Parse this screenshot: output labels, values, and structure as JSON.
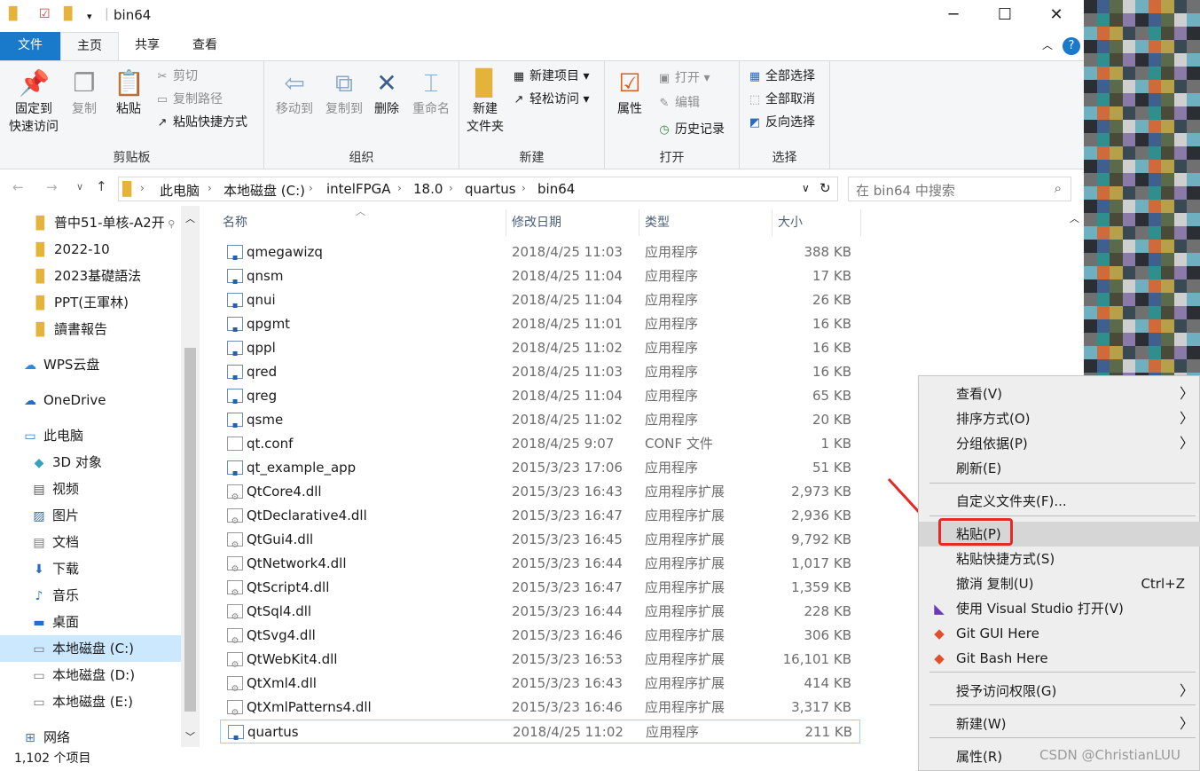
{
  "window": {
    "title": "bin64"
  },
  "tabs": [
    "文件",
    "主页",
    "共享",
    "查看"
  ],
  "ribbon": {
    "clipboard": {
      "label": "剪贴板",
      "pin": "固定到\n快速访问",
      "pin1": "固定到",
      "pin2": "快速访问",
      "copy": "复制",
      "paste": "粘贴",
      "cut": "剪切",
      "copy_path": "复制路径",
      "paste_shortcut": "粘贴快捷方式"
    },
    "organize": {
      "label": "组织",
      "move_to": "移动到",
      "copy_to": "复制到",
      "delete": "删除",
      "rename": "重命名"
    },
    "new": {
      "label": "新建",
      "new_folder1": "新建",
      "new_folder2": "文件夹",
      "new_item": "新建项目",
      "easy_access": "轻松访问"
    },
    "open": {
      "label": "打开",
      "properties": "属性",
      "open": "打开",
      "edit": "编辑",
      "history": "历史记录"
    },
    "select": {
      "label": "选择",
      "select_all": "全部选择",
      "select_none": "全部取消",
      "invert": "反向选择"
    }
  },
  "address": {
    "crumbs": [
      "此电脑",
      "本地磁盘 (C:)",
      "intelFPGA",
      "18.0",
      "quartus",
      "bin64"
    ],
    "search_placeholder": "在 bin64 中搜索"
  },
  "nav": {
    "items": [
      {
        "label": "普中51-单核-A2开",
        "icon": "folder-icon"
      },
      {
        "label": "2022-10",
        "icon": "folder-icon"
      },
      {
        "label": "2023基礎語法",
        "icon": "folder-icon"
      },
      {
        "label": "PPT(王軍林)",
        "icon": "folder-icon"
      },
      {
        "label": "讀書報告",
        "icon": "folder-icon"
      },
      {
        "label": "WPS云盘",
        "icon": "cloud-icon"
      },
      {
        "label": "OneDrive",
        "icon": "onedrive-icon"
      },
      {
        "label": "此电脑",
        "icon": "computer-icon"
      },
      {
        "label": "3D 对象",
        "icon": "cube-icon"
      },
      {
        "label": "视频",
        "icon": "video-icon"
      },
      {
        "label": "图片",
        "icon": "picture-icon"
      },
      {
        "label": "文档",
        "icon": "document-icon"
      },
      {
        "label": "下载",
        "icon": "download-icon"
      },
      {
        "label": "音乐",
        "icon": "music-icon"
      },
      {
        "label": "桌面",
        "icon": "desktop-icon"
      },
      {
        "label": "本地磁盘 (C:)",
        "icon": "drive-icon"
      },
      {
        "label": "本地磁盘 (D:)",
        "icon": "drive-icon"
      },
      {
        "label": "本地磁盘 (E:)",
        "icon": "drive-icon"
      },
      {
        "label": "网络",
        "icon": "network-icon"
      }
    ]
  },
  "columns": {
    "name": "名称",
    "date": "修改日期",
    "type": "类型",
    "size": "大小"
  },
  "files": [
    {
      "name": "qmegawizq",
      "date": "2018/4/25 11:03",
      "type": "应用程序",
      "size": "388 KB"
    },
    {
      "name": "qnsm",
      "date": "2018/4/25 11:04",
      "type": "应用程序",
      "size": "17 KB"
    },
    {
      "name": "qnui",
      "date": "2018/4/25 11:04",
      "type": "应用程序",
      "size": "26 KB"
    },
    {
      "name": "qpgmt",
      "date": "2018/4/25 11:01",
      "type": "应用程序",
      "size": "16 KB"
    },
    {
      "name": "qppl",
      "date": "2018/4/25 11:02",
      "type": "应用程序",
      "size": "16 KB"
    },
    {
      "name": "qred",
      "date": "2018/4/25 11:03",
      "type": "应用程序",
      "size": "16 KB"
    },
    {
      "name": "qreg",
      "date": "2018/4/25 11:04",
      "type": "应用程序",
      "size": "65 KB"
    },
    {
      "name": "qsme",
      "date": "2018/4/25 11:02",
      "type": "应用程序",
      "size": "20 KB"
    },
    {
      "name": "qt.conf",
      "date": "2018/4/25 9:07",
      "type": "CONF 文件",
      "size": "1 KB"
    },
    {
      "name": "qt_example_app",
      "date": "2015/3/23 17:06",
      "type": "应用程序",
      "size": "51 KB"
    },
    {
      "name": "QtCore4.dll",
      "date": "2015/3/23 16:43",
      "type": "应用程序扩展",
      "size": "2,973 KB"
    },
    {
      "name": "QtDeclarative4.dll",
      "date": "2015/3/23 16:47",
      "type": "应用程序扩展",
      "size": "2,936 KB"
    },
    {
      "name": "QtGui4.dll",
      "date": "2015/3/23 16:45",
      "type": "应用程序扩展",
      "size": "9,792 KB"
    },
    {
      "name": "QtNetwork4.dll",
      "date": "2015/3/23 16:44",
      "type": "应用程序扩展",
      "size": "1,017 KB"
    },
    {
      "name": "QtScript4.dll",
      "date": "2015/3/23 16:47",
      "type": "应用程序扩展",
      "size": "1,359 KB"
    },
    {
      "name": "QtSql4.dll",
      "date": "2015/3/23 16:44",
      "type": "应用程序扩展",
      "size": "228 KB"
    },
    {
      "name": "QtSvg4.dll",
      "date": "2015/3/23 16:46",
      "type": "应用程序扩展",
      "size": "306 KB"
    },
    {
      "name": "QtWebKit4.dll",
      "date": "2015/3/23 16:53",
      "type": "应用程序扩展",
      "size": "16,101 KB"
    },
    {
      "name": "QtXml4.dll",
      "date": "2015/3/23 16:43",
      "type": "应用程序扩展",
      "size": "414 KB"
    },
    {
      "name": "QtXmlPatterns4.dll",
      "date": "2015/3/23 16:46",
      "type": "应用程序扩展",
      "size": "3,317 KB"
    },
    {
      "name": "quartus",
      "date": "2018/4/25 11:02",
      "type": "应用程序",
      "size": "211 KB"
    }
  ],
  "status": {
    "count": "1,102 个项目"
  },
  "context_menu": {
    "items": [
      {
        "label": "查看(V)",
        "submenu": true
      },
      {
        "label": "排序方式(O)",
        "submenu": true
      },
      {
        "label": "分组依据(P)",
        "submenu": true
      },
      {
        "label": "刷新(E)"
      },
      {
        "label": "自定义文件夹(F)..."
      },
      {
        "label": "粘贴(P)",
        "highlighted": true
      },
      {
        "label": "粘贴快捷方式(S)"
      },
      {
        "label": "撤消 复制(U)",
        "shortcut": "Ctrl+Z"
      },
      {
        "label": "使用 Visual Studio 打开(V)",
        "icon": "visual-studio-icon"
      },
      {
        "label": "Git GUI Here",
        "icon": "git-icon"
      },
      {
        "label": "Git Bash Here",
        "icon": "git-icon"
      },
      {
        "label": "授予访问权限(G)",
        "submenu": true
      },
      {
        "label": "新建(W)",
        "submenu": true
      },
      {
        "label": "属性(R)"
      }
    ]
  },
  "watermark": "CSDN @ChristianLUU",
  "colors": {
    "accent": "#1979ca",
    "highlight": "#e52a27",
    "menu_bg": "#eeeeee"
  }
}
